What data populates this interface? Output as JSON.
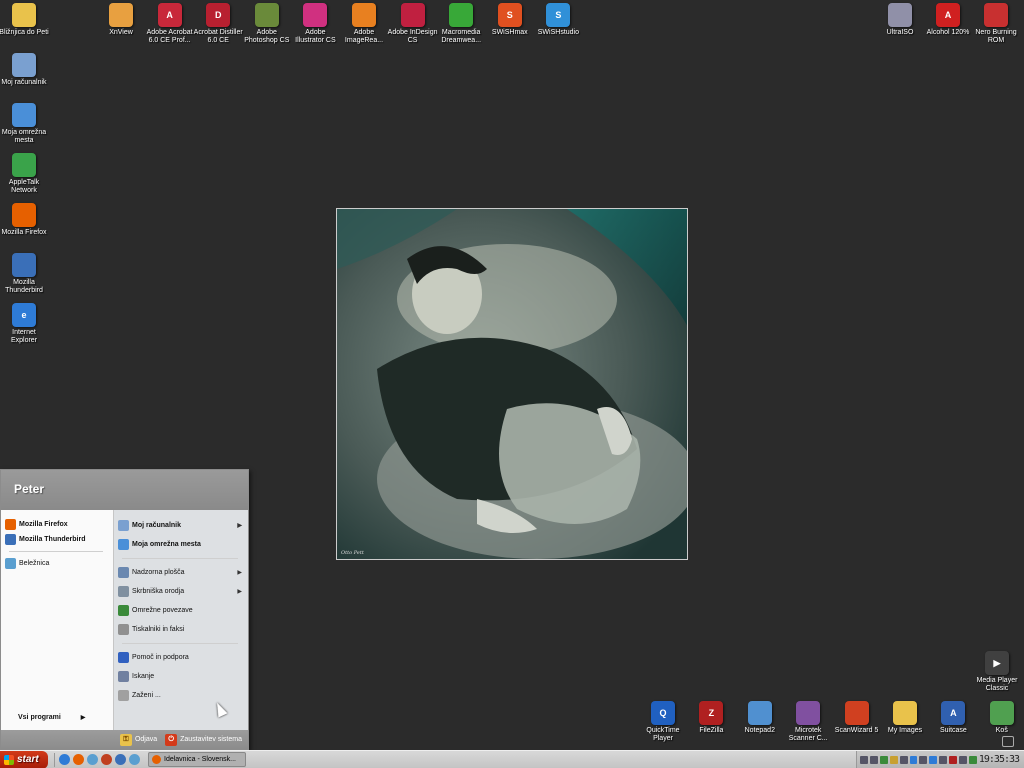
{
  "desktop": {
    "left_icons": [
      {
        "name": "folder-icon",
        "label": "Bližnjica do Peti",
        "color": "#e9c24b",
        "glyph": ""
      },
      {
        "name": "computer-icon",
        "label": "Moj računalnik",
        "color": "#7aa0d0",
        "glyph": ""
      },
      {
        "name": "network-places-icon",
        "label": "Moja omrežna mesta",
        "color": "#4a8fd8",
        "glyph": ""
      },
      {
        "name": "appletalk-icon",
        "label": "AppleTalk Network",
        "color": "#3aa34a",
        "glyph": ""
      },
      {
        "name": "firefox-icon",
        "label": "Mozilla Firefox",
        "color": "#e66000",
        "glyph": ""
      },
      {
        "name": "thunderbird-icon",
        "label": "Mozilla Thunderbird",
        "color": "#3a6fb8",
        "glyph": ""
      },
      {
        "name": "internet-explorer-icon",
        "label": "Internet Explorer",
        "color": "#2e7bd6",
        "glyph": "e"
      }
    ],
    "top_icons": [
      {
        "name": "xnview-icon",
        "label": "XnView",
        "color": "#e8a040",
        "glyph": ""
      },
      {
        "name": "acrobat-icon",
        "label": "Adobe Acrobat 6.0 CE Prof...",
        "color": "#c8283a",
        "glyph": "A"
      },
      {
        "name": "acrobat-distiller-icon",
        "label": "Acrobat Distiller 6.0 CE",
        "color": "#b82030",
        "glyph": "D"
      },
      {
        "name": "photoshop-icon",
        "label": "Adobe Photoshop CS",
        "color": "#6a8a3a",
        "glyph": ""
      },
      {
        "name": "illustrator-icon",
        "label": "Adobe Illustrator CS",
        "color": "#d03080",
        "glyph": ""
      },
      {
        "name": "imageready-icon",
        "label": "Adobe ImageRea...",
        "color": "#e88020",
        "glyph": ""
      },
      {
        "name": "indesign-icon",
        "label": "Adobe InDesign CS",
        "color": "#c02040",
        "glyph": ""
      },
      {
        "name": "dreamweaver-icon",
        "label": "Macromedia Dreamwea...",
        "color": "#38a838",
        "glyph": ""
      },
      {
        "name": "swishmax-icon",
        "label": "SWiSHmax",
        "color": "#e05020",
        "glyph": "S"
      },
      {
        "name": "swishstudio-icon",
        "label": "SWiSHstudio",
        "color": "#3090d8",
        "glyph": "S"
      }
    ],
    "top_right_icons": [
      {
        "name": "ultraiso-icon",
        "label": "UltraISO",
        "color": "#9090a8",
        "glyph": ""
      },
      {
        "name": "alcohol-icon",
        "label": "Alcohol 120%",
        "color": "#d02020",
        "glyph": "A"
      },
      {
        "name": "nero-icon",
        "label": "Nero Burning ROM",
        "color": "#c83030",
        "glyph": ""
      }
    ],
    "bottom_right_icons": [
      {
        "name": "quicktime-icon",
        "label": "QuickTime Player",
        "color": "#2060c0",
        "glyph": "Q"
      },
      {
        "name": "filezilla-icon",
        "label": "FileZilla",
        "color": "#b02020",
        "glyph": "Z"
      },
      {
        "name": "notepad2-icon",
        "label": "Notepad2",
        "color": "#5090d0",
        "glyph": ""
      },
      {
        "name": "microtek-scanner-icon",
        "label": "Microtek Scanner C...",
        "color": "#8050a0",
        "glyph": ""
      },
      {
        "name": "scanwizard-icon",
        "label": "ScanWizard 5",
        "color": "#d04020",
        "glyph": ""
      },
      {
        "name": "my-images-folder-icon",
        "label": "My Images",
        "color": "#e9c24b",
        "glyph": ""
      },
      {
        "name": "suitcase-icon",
        "label": "Suitcase",
        "color": "#3060b0",
        "glyph": "A"
      },
      {
        "name": "recycle-bin-icon",
        "label": "Koš",
        "color": "#50a050",
        "glyph": ""
      }
    ],
    "media_player": {
      "label": "Media Player Classic",
      "color": "#404040"
    },
    "wallpaper_signature": "Otto Pett"
  },
  "start_menu": {
    "user": "Peter",
    "pinned": [
      {
        "name": "firefox",
        "label": "Mozilla Firefox",
        "color": "#e66000"
      },
      {
        "name": "thunderbird",
        "label": "Mozilla Thunderbird",
        "color": "#3a6fb8"
      }
    ],
    "recent": [
      {
        "name": "notepad",
        "label": "Beležnica",
        "color": "#5a9fd0"
      }
    ],
    "all_programs": "Vsi programi",
    "right_items": [
      {
        "name": "my-computer",
        "label": "Moj računalnik",
        "bold": true,
        "arrow": true,
        "color": "#7aa0d0"
      },
      {
        "name": "network-places",
        "label": "Moja omrežna mesta",
        "bold": true,
        "arrow": false,
        "color": "#4a8fd8"
      },
      {
        "sep": true
      },
      {
        "name": "control-panel",
        "label": "Nadzorna plošča",
        "bold": false,
        "arrow": true,
        "color": "#6a88b0"
      },
      {
        "name": "admin-tools",
        "label": "Skrbniška orodja",
        "bold": false,
        "arrow": true,
        "color": "#8090a0"
      },
      {
        "name": "network-connections",
        "label": "Omrežne povezave",
        "bold": false,
        "arrow": false,
        "color": "#3a8a3a"
      },
      {
        "name": "printers-faxes",
        "label": "Tiskalniki in faksi",
        "bold": false,
        "arrow": false,
        "color": "#909090"
      },
      {
        "sep": true
      },
      {
        "name": "help-support",
        "label": "Pomoč in podpora",
        "bold": false,
        "arrow": false,
        "color": "#3060c0"
      },
      {
        "name": "search",
        "label": "Iskanje",
        "bold": false,
        "arrow": false,
        "color": "#7080a0"
      },
      {
        "name": "run",
        "label": "Zaženi ...",
        "bold": false,
        "arrow": false,
        "color": "#a0a0a0"
      }
    ],
    "logoff": "Odjava",
    "shutdown": "Zaustavitev sistema"
  },
  "taskbar": {
    "start": "start",
    "quick_launch": [
      "#2e7bd6",
      "#e66000",
      "#5a9fd0",
      "#c04020",
      "#3a6fb8",
      "#5a9fd0"
    ],
    "task": "Idelavnica - Slovensk...",
    "clock": "19:35:33"
  }
}
